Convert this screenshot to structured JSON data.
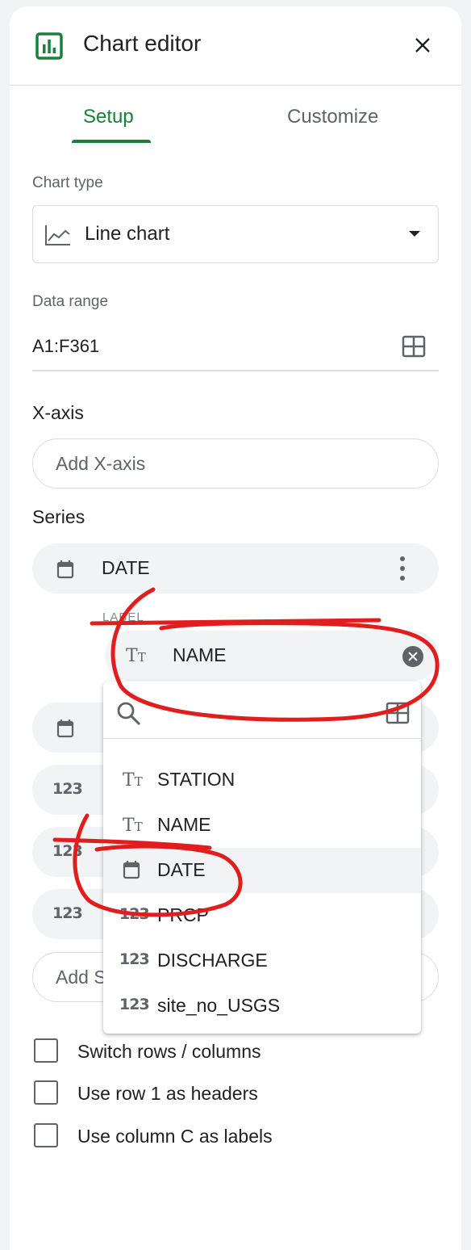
{
  "header": {
    "title": "Chart editor"
  },
  "tabs": [
    {
      "label": "Setup"
    },
    {
      "label": "Customize"
    }
  ],
  "chart_type": {
    "label": "Chart type",
    "value": "Line chart"
  },
  "data_range": {
    "label": "Data range",
    "value": "A1:F361"
  },
  "x_axis": {
    "heading": "X-axis",
    "add_label": "Add X-axis"
  },
  "series": {
    "heading": "Series",
    "first": "DATE",
    "label_caption": "LABEL",
    "label_value": "NAME",
    "add_label": "Add S",
    "row_icon_text": "123"
  },
  "dropdown": {
    "items": [
      {
        "label": "STATION",
        "icon": "text-type-icon"
      },
      {
        "label": "NAME",
        "icon": "text-type-icon"
      },
      {
        "label": "DATE",
        "icon": "calendar-icon"
      },
      {
        "label": "PRCP",
        "icon": "number-type-icon"
      },
      {
        "label": "DISCHARGE",
        "icon": "number-type-icon"
      },
      {
        "label": "site_no_USGS",
        "icon": "number-type-icon"
      }
    ]
  },
  "options": [
    {
      "label": "Switch rows / columns",
      "checked": false
    },
    {
      "label": "Use row 1 as headers",
      "checked": false
    },
    {
      "label": "Use column C as labels",
      "checked": false
    }
  ],
  "colors": {
    "accent": "#188038",
    "annotation": "#e01e1e"
  }
}
